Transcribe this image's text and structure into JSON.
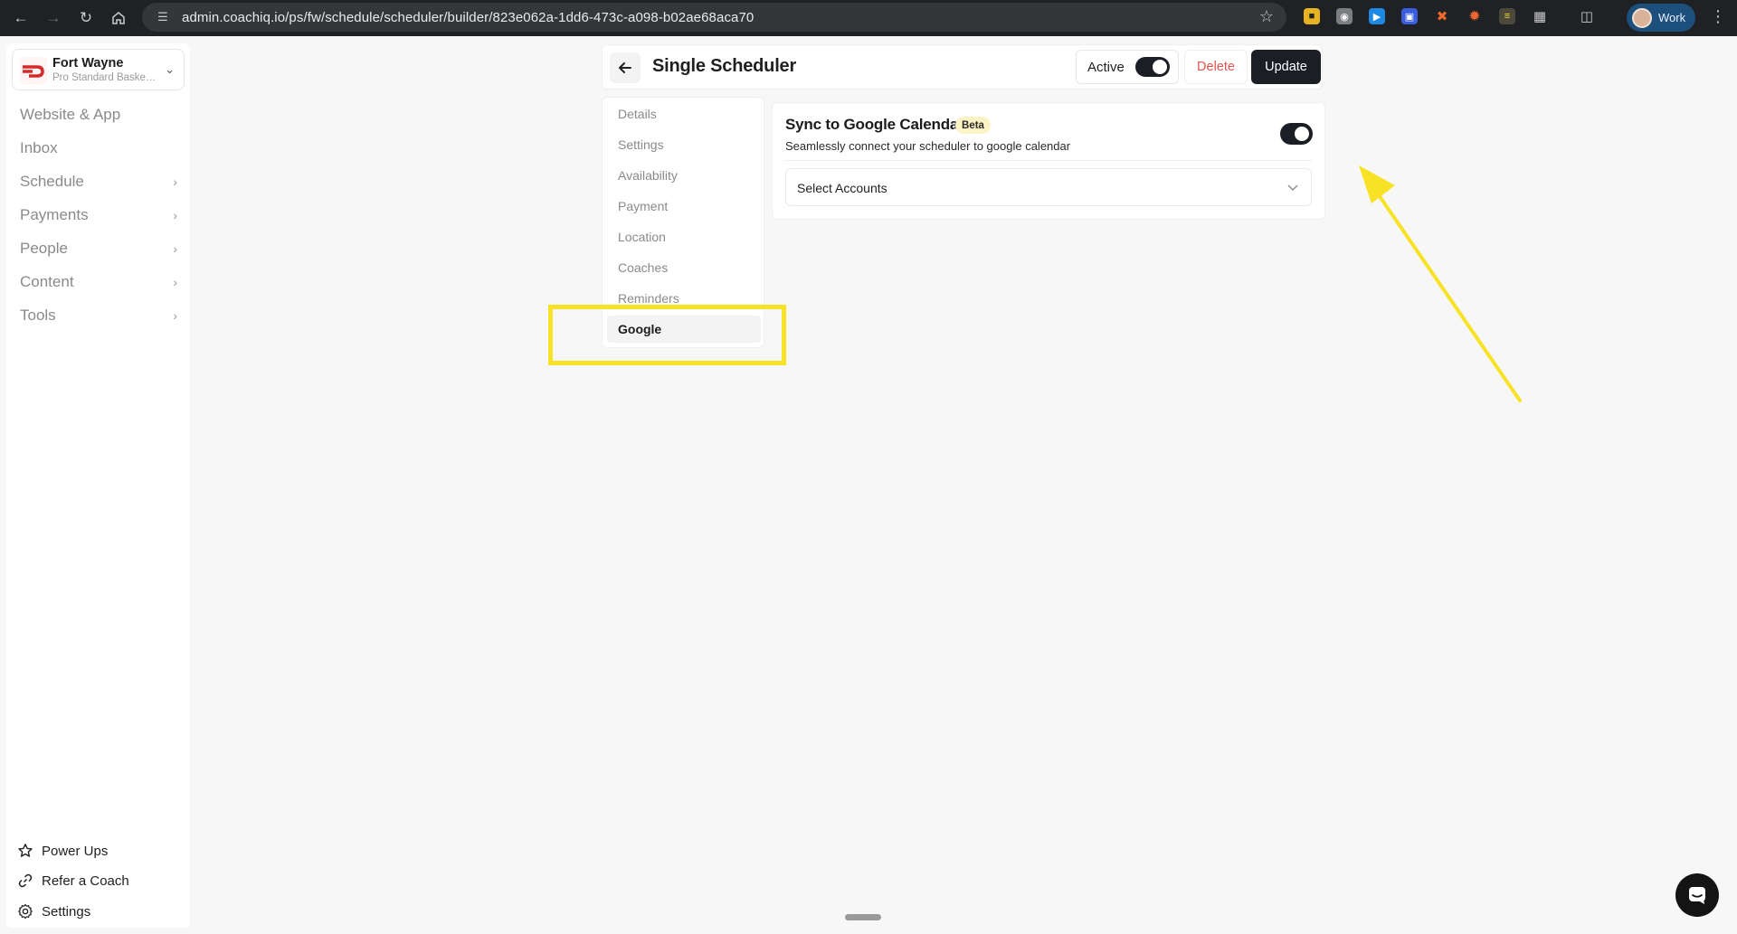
{
  "browser": {
    "url": "admin.coachiq.io/ps/fw/schedule/scheduler/builder/823e062a-1dd6-473c-a098-b02ae68aca70",
    "profile_name": "Work"
  },
  "sidebar": {
    "org": {
      "name": "Fort Wayne",
      "subtitle": "Pro Standard Basketball"
    },
    "items": [
      {
        "label": "Website & App",
        "has_chevron": false
      },
      {
        "label": "Inbox",
        "has_chevron": false
      },
      {
        "label": "Schedule",
        "has_chevron": true
      },
      {
        "label": "Payments",
        "has_chevron": true
      },
      {
        "label": "People",
        "has_chevron": true
      },
      {
        "label": "Content",
        "has_chevron": true
      },
      {
        "label": "Tools",
        "has_chevron": true
      }
    ],
    "footer": [
      {
        "label": "Power Ups",
        "icon": "star-icon"
      },
      {
        "label": "Refer a Coach",
        "icon": "link-icon"
      },
      {
        "label": "Settings",
        "icon": "gear-icon"
      }
    ]
  },
  "header": {
    "title": "Single Scheduler",
    "active_label": "Active",
    "active_on": true,
    "delete_label": "Delete",
    "update_label": "Update"
  },
  "submenu": {
    "items": [
      "Details",
      "Settings",
      "Availability",
      "Payment",
      "Location",
      "Coaches",
      "Reminders",
      "Google"
    ],
    "selected": "Google"
  },
  "google_panel": {
    "title": "Sync to Google Calendar",
    "badge": "Beta",
    "description": "Seamlessly connect your scheduler to google calendar",
    "sync_on": true,
    "select_placeholder": "Select Accounts"
  },
  "colors": {
    "accent_dark": "#1c1e26",
    "delete_red": "#e2554f",
    "annotation_yellow": "#f7e225",
    "beta_bg": "#fbf3c4"
  }
}
